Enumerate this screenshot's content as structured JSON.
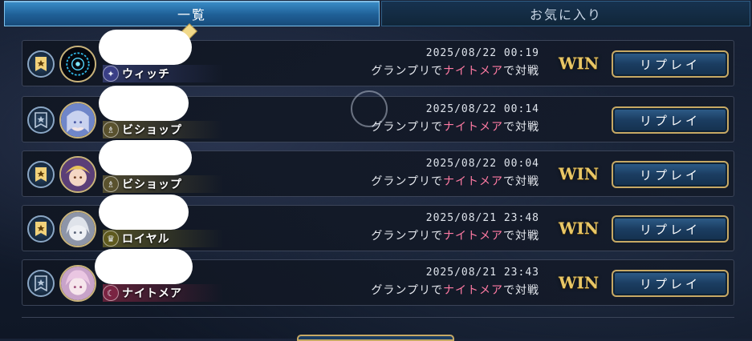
{
  "tabs": [
    {
      "label": "一覧",
      "active": true
    },
    {
      "label": "お気に入り",
      "active": false
    }
  ],
  "rows": [
    {
      "date": "2025/08/22 00:19",
      "desc_pre": "グランプリで",
      "desc_hl": "ナイトメア",
      "desc_post": "で対戦",
      "result": "WIN",
      "class_label": "ウィッチ",
      "class_icon": "witch-icon",
      "replay_label": "リプレイ",
      "avatar": "avatar-witch-dark"
    },
    {
      "date": "2025/08/22 00:14",
      "desc_pre": "グランプリで",
      "desc_hl": "ナイトメア",
      "desc_post": "で対戦",
      "result": "",
      "class_label": "ビショップ",
      "class_icon": "bishop-icon",
      "replay_label": "リプレイ",
      "avatar": "avatar-bishop-blue"
    },
    {
      "date": "2025/08/22 00:04",
      "desc_pre": "グランプリで",
      "desc_hl": "ナイトメア",
      "desc_post": "で対戦",
      "result": "WIN",
      "class_label": "ビショップ",
      "class_icon": "bishop-icon",
      "replay_label": "リプレイ",
      "avatar": "avatar-bishop-purple"
    },
    {
      "date": "2025/08/21 23:48",
      "desc_pre": "グランプリで",
      "desc_hl": "ナイトメア",
      "desc_post": "で対戦",
      "result": "WIN",
      "class_label": "ロイヤル",
      "class_icon": "royal-icon",
      "replay_label": "リプレイ",
      "avatar": "avatar-royal-silver"
    },
    {
      "date": "2025/08/21 23:43",
      "desc_pre": "グランプリで",
      "desc_hl": "ナイトメア",
      "desc_post": "で対戦",
      "result": "WIN",
      "class_label": "ナイトメア",
      "class_icon": "nightmare-icon",
      "replay_label": "リプレイ",
      "avatar": "avatar-nightmare-pink"
    }
  ],
  "colors": {
    "accent_gold": "#c7a964",
    "highlight_pink": "#ff7aa3",
    "tab_active": "#2a78b4"
  }
}
